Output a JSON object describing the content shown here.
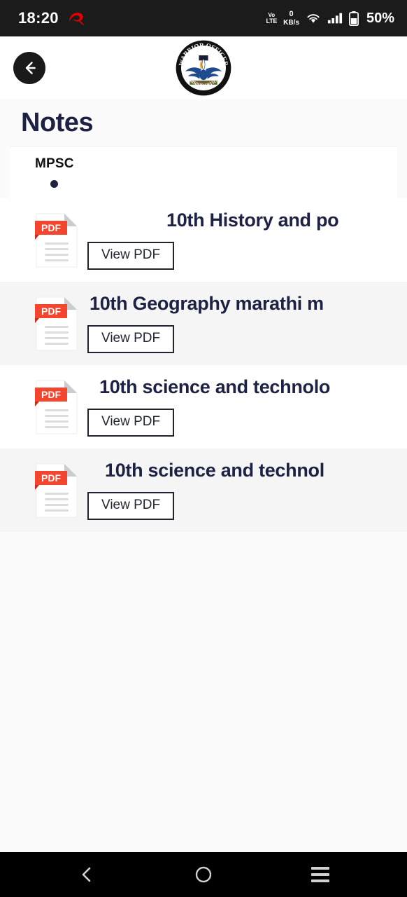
{
  "status_bar": {
    "clock": "18:20",
    "carrier_icon": "airtel-logo-icon",
    "volte_top": "Vo",
    "volte_bottom": "LTE",
    "net_speed_value": "0",
    "net_speed_unit": "KB/s",
    "wifi_icon": "wifi-icon",
    "signal_icon": "cellular-signal-icon",
    "battery_icon": "battery-icon",
    "battery_percent": "50%"
  },
  "header": {
    "back_icon": "arrow-left-icon",
    "logo_icon": "warrior-officer-logo-icon",
    "logo_top_text": "WARRIOR OFFICER",
    "logo_bottom_text": "MARATHI BOOKS"
  },
  "page": {
    "title": "Notes"
  },
  "tabs": [
    {
      "label": "MPSC",
      "selected": true
    }
  ],
  "notes": [
    {
      "title": "10th History and po",
      "button_label": "View PDF",
      "icon": "pdf-file-icon"
    },
    {
      "title": "10th Geography marathi m",
      "button_label": "View PDF",
      "icon": "pdf-file-icon"
    },
    {
      "title": "10th science and technolo",
      "button_label": "View PDF",
      "icon": "pdf-file-icon"
    },
    {
      "title": "10th science and technol",
      "button_label": "View PDF",
      "icon": "pdf-file-icon"
    }
  ],
  "nav_bar": {
    "back_icon": "nav-back-icon",
    "home_icon": "nav-home-icon",
    "recents_icon": "nav-recents-icon"
  },
  "colors": {
    "title_navy": "#1d2143",
    "pdf_red": "#f4452f",
    "status_bg": "#1b1b1b",
    "nav_bg": "#000000",
    "row_alt": "#f5f5f5"
  }
}
